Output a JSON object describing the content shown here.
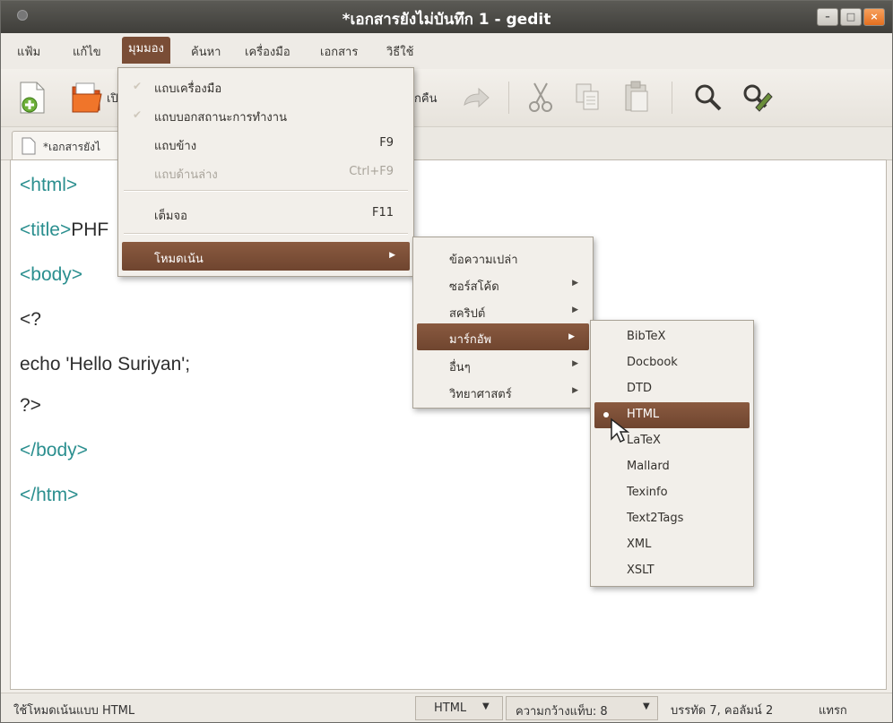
{
  "window": {
    "title": "*เอกสารยังไม่บันทึก 1 - gedit"
  },
  "menubar": [
    "แฟ้ม",
    "แก้ไข",
    "มุมมอง",
    "ค้นหา",
    "เครื่องมือ",
    "เอกสาร",
    "วิธีใช้"
  ],
  "toolbar": {
    "new_icon": "new-document-icon",
    "open_label": "เปิ",
    "undo_label": "กคืน"
  },
  "tab": {
    "label": "*เอกสารยังไ"
  },
  "view_menu": {
    "toolbar_item": "แถบเครื่องมือ",
    "statusbar_item": "แถบบอกสถานะการทำงาน",
    "sidepane_item": "แถบข้าง",
    "sidepane_accel": "F9",
    "bottompane_item": "แถบด้านล่าง",
    "bottompane_accel": "Ctrl+F9",
    "fullscreen_item": "เต็มจอ",
    "fullscreen_accel": "F11",
    "highlight_item": "โหมดเน้น"
  },
  "highlight_menu": {
    "plain": "ข้อความเปล่า",
    "source": "ซอร์สโค้ด",
    "script": "สคริปต์",
    "markup": "มาร์กอัพ",
    "other": "อื่นๆ",
    "science": "วิทยาศาสตร์"
  },
  "markup_menu": [
    "BibTeX",
    "Docbook",
    "DTD",
    "HTML",
    "LaTeX",
    "Mallard",
    "Texinfo",
    "Text2Tags",
    "XML",
    "XSLT"
  ],
  "editor": {
    "lines": [
      {
        "tag": "<html>",
        "rest": ""
      },
      {
        "tag": "<title>",
        "rest": "PHF"
      },
      {
        "tag": "<body>",
        "rest": ""
      },
      {
        "tag": "",
        "rest": "<?"
      },
      {
        "tag": "",
        "rest": "echo 'Hello Suriyan';"
      },
      {
        "tag": "",
        "rest": "?>"
      },
      {
        "tag": "</body>",
        "rest": ""
      },
      {
        "tag": "</htm>",
        "rest": ""
      }
    ]
  },
  "statusbar": {
    "message": "ใช้โหมดเน้นแบบ HTML",
    "language": "HTML",
    "tab_width": "ความกว้างแท็บ: 8",
    "position": "บรรทัด 7, คอลัมน์ 2",
    "mode": "แทรก"
  },
  "colors": {
    "accent": "#7a4d36",
    "tag": "#2b8f8f"
  }
}
